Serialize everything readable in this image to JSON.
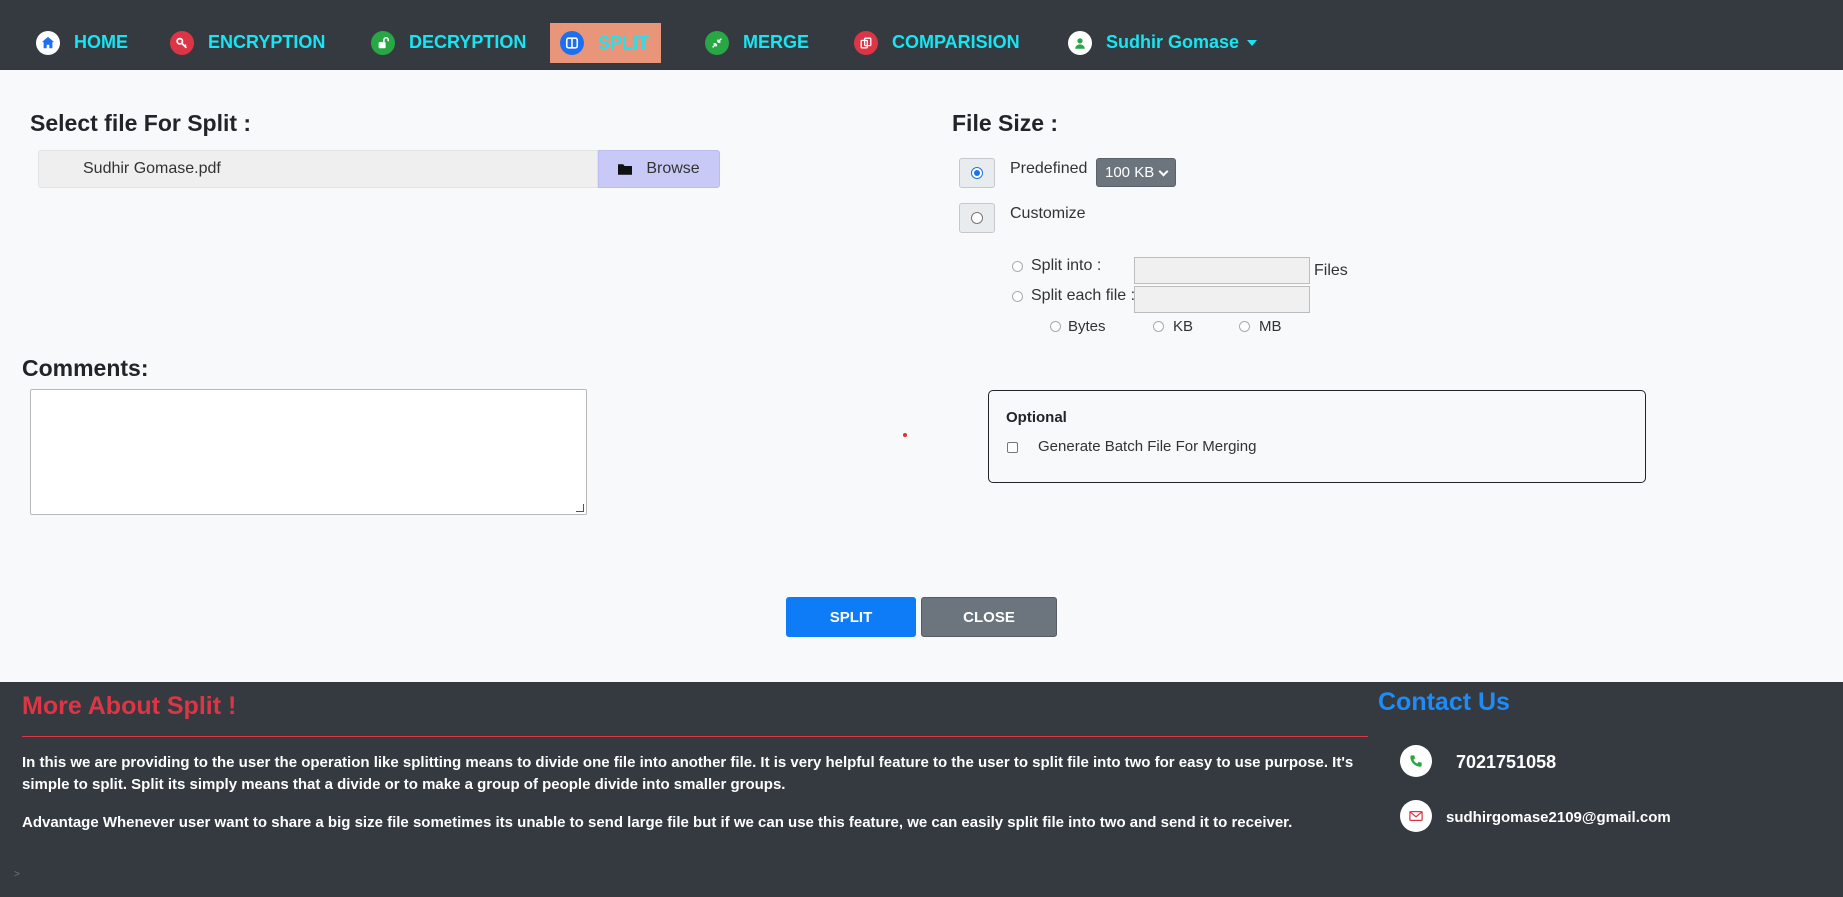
{
  "nav": {
    "items": [
      {
        "label": "HOME",
        "icon": "home-icon",
        "color": "#1d6ff2"
      },
      {
        "label": "ENCRYPTION",
        "icon": "key-icon",
        "color": "#dc3545"
      },
      {
        "label": "DECRYPTION",
        "icon": "unlock-icon",
        "color": "#28a745"
      },
      {
        "label": "SPLIT",
        "icon": "split-icon",
        "color": "#1d6ff2",
        "active": true
      },
      {
        "label": "MERGE",
        "icon": "merge-icon",
        "color": "#28a745"
      },
      {
        "label": "COMPARISION",
        "icon": "compare-icon",
        "color": "#dc3545"
      }
    ],
    "user": {
      "label": "Sudhir Gomase",
      "icon": "user-icon",
      "color": "#28a745"
    }
  },
  "split_form": {
    "select_heading": "Select file For Split :",
    "file_name": "Sudhir Gomase.pdf",
    "browse_label": "Browse",
    "file_size_heading": "File Size :",
    "predefined_label": "Predefined",
    "predefined_value": "100 KB",
    "customize_label": "Customize",
    "split_into_label": "Split into :",
    "files_label": "Files",
    "split_each_label": "Split each file :",
    "units": [
      "Bytes",
      "KB",
      "MB"
    ],
    "comments_heading": "Comments:",
    "optional_heading": "Optional",
    "batch_label": "Generate Batch File For Merging",
    "split_button": "SPLIT",
    "close_button": "CLOSE"
  },
  "footer": {
    "title": "More About Split !",
    "paragraph1": "In this we are providing to the user the operation like splitting means to divide one file into another file. It is very helpful feature to the user to split file into two for easy to use purpose. It's simple to split. Split its simply means that a divide or to make a group of people divide into smaller groups.",
    "paragraph2": "Advantage Whenever user want to share a big size file sometimes its unable to send large file but if we can use this feature, we can easily split file into two and send it to receiver.",
    "contact_title": "Contact Us",
    "phone": "7021751058",
    "email": "sudhirgomase2109@gmail.com"
  },
  "colors": {
    "navbar": "#343a40",
    "nav_text": "#17e6f2",
    "active_tab": "#e8957a",
    "primary": "#0d7cf6",
    "secondary": "#6c757d",
    "danger": "#dc3545"
  }
}
